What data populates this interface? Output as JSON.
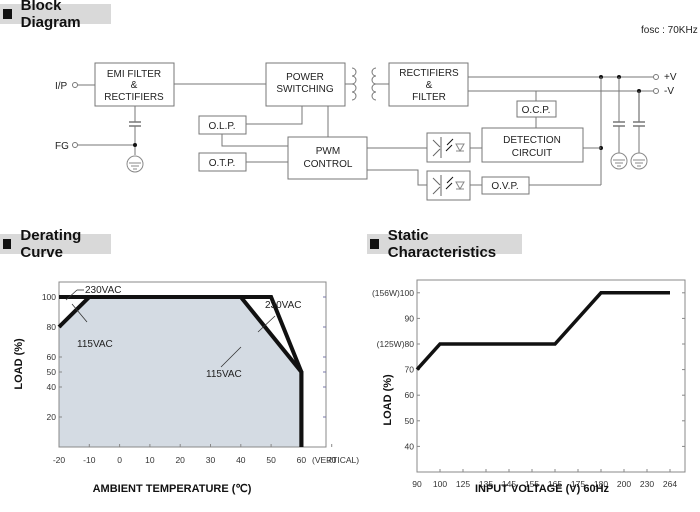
{
  "sections": {
    "block_diagram": "Block Diagram",
    "derating_curve": "Derating Curve",
    "static_characteristics": "Static Characteristics"
  },
  "block_diagram": {
    "fosc": "fosc : 70KHz",
    "terminals": {
      "input": "I/P",
      "fg": "FG",
      "plus_v": "+V",
      "minus_v": "-V"
    },
    "blocks": {
      "emi": [
        "EMI FILTER",
        "&",
        "RECTIFIERS"
      ],
      "power": [
        "POWER",
        "SWITCHING"
      ],
      "rect": [
        "RECTIFIERS",
        "&",
        "FILTER"
      ],
      "olp": "O.L.P.",
      "otp": "O.T.P.",
      "pwm": [
        "PWM",
        "CONTROL"
      ],
      "ocp": "O.C.P.",
      "detection": [
        "DETECTION",
        "CIRCUIT"
      ],
      "ovp": "O.V.P."
    }
  },
  "chart_data": [
    {
      "type": "line",
      "title": "Derating Curve",
      "xlabel": "AMBIENT TEMPERATURE (℃)",
      "ylabel": "LOAD (%)",
      "x_ticks": [
        "-20",
        "-10",
        "0",
        "10",
        "20",
        "30",
        "40",
        "50",
        "60",
        "70"
      ],
      "x_tick_values": [
        -20,
        -10,
        0,
        10,
        20,
        30,
        40,
        50,
        60,
        70
      ],
      "x_suffix": "(VERTICAL)",
      "y_ticks": [
        "20",
        "40",
        "50",
        "60",
        "80",
        "100"
      ],
      "y_tick_values": [
        20,
        40,
        50,
        60,
        80,
        100
      ],
      "xlim": [
        -20,
        80
      ],
      "ylim": [
        0,
        110
      ],
      "series": [
        {
          "name": "230VAC",
          "x": [
            -20,
            50,
            60,
            60
          ],
          "y": [
            100,
            100,
            50,
            0
          ]
        },
        {
          "name": "115VAC",
          "x": [
            -20,
            -10,
            40,
            60,
            60
          ],
          "y": [
            80,
            100,
            100,
            50,
            0
          ]
        }
      ],
      "fill": {
        "area_under": "115VAC",
        "color": "#d4dbe3"
      },
      "annotations": [
        "230VAC",
        "115VAC",
        "230VAC",
        "115VAC"
      ]
    },
    {
      "type": "line",
      "title": "Static Characteristics",
      "xlabel": "INPUT VOLTAGE (V) 60Hz",
      "ylabel": "LOAD (%)",
      "x_ticks": [
        "90",
        "100",
        "125",
        "135",
        "145",
        "155",
        "165",
        "175",
        "180",
        "200",
        "230",
        "264"
      ],
      "y_ticks": [
        "40",
        "50",
        "60",
        "70",
        "(125W)80",
        "90",
        "(156W)100"
      ],
      "y_tick_values": [
        40,
        50,
        60,
        70,
        80,
        90,
        100
      ],
      "ylim": [
        30,
        105
      ],
      "series": [
        {
          "name": "Load",
          "x": [
            "90",
            "100",
            "165",
            "180",
            "264"
          ],
          "y": [
            70,
            80,
            80,
            100,
            100
          ]
        }
      ]
    }
  ]
}
